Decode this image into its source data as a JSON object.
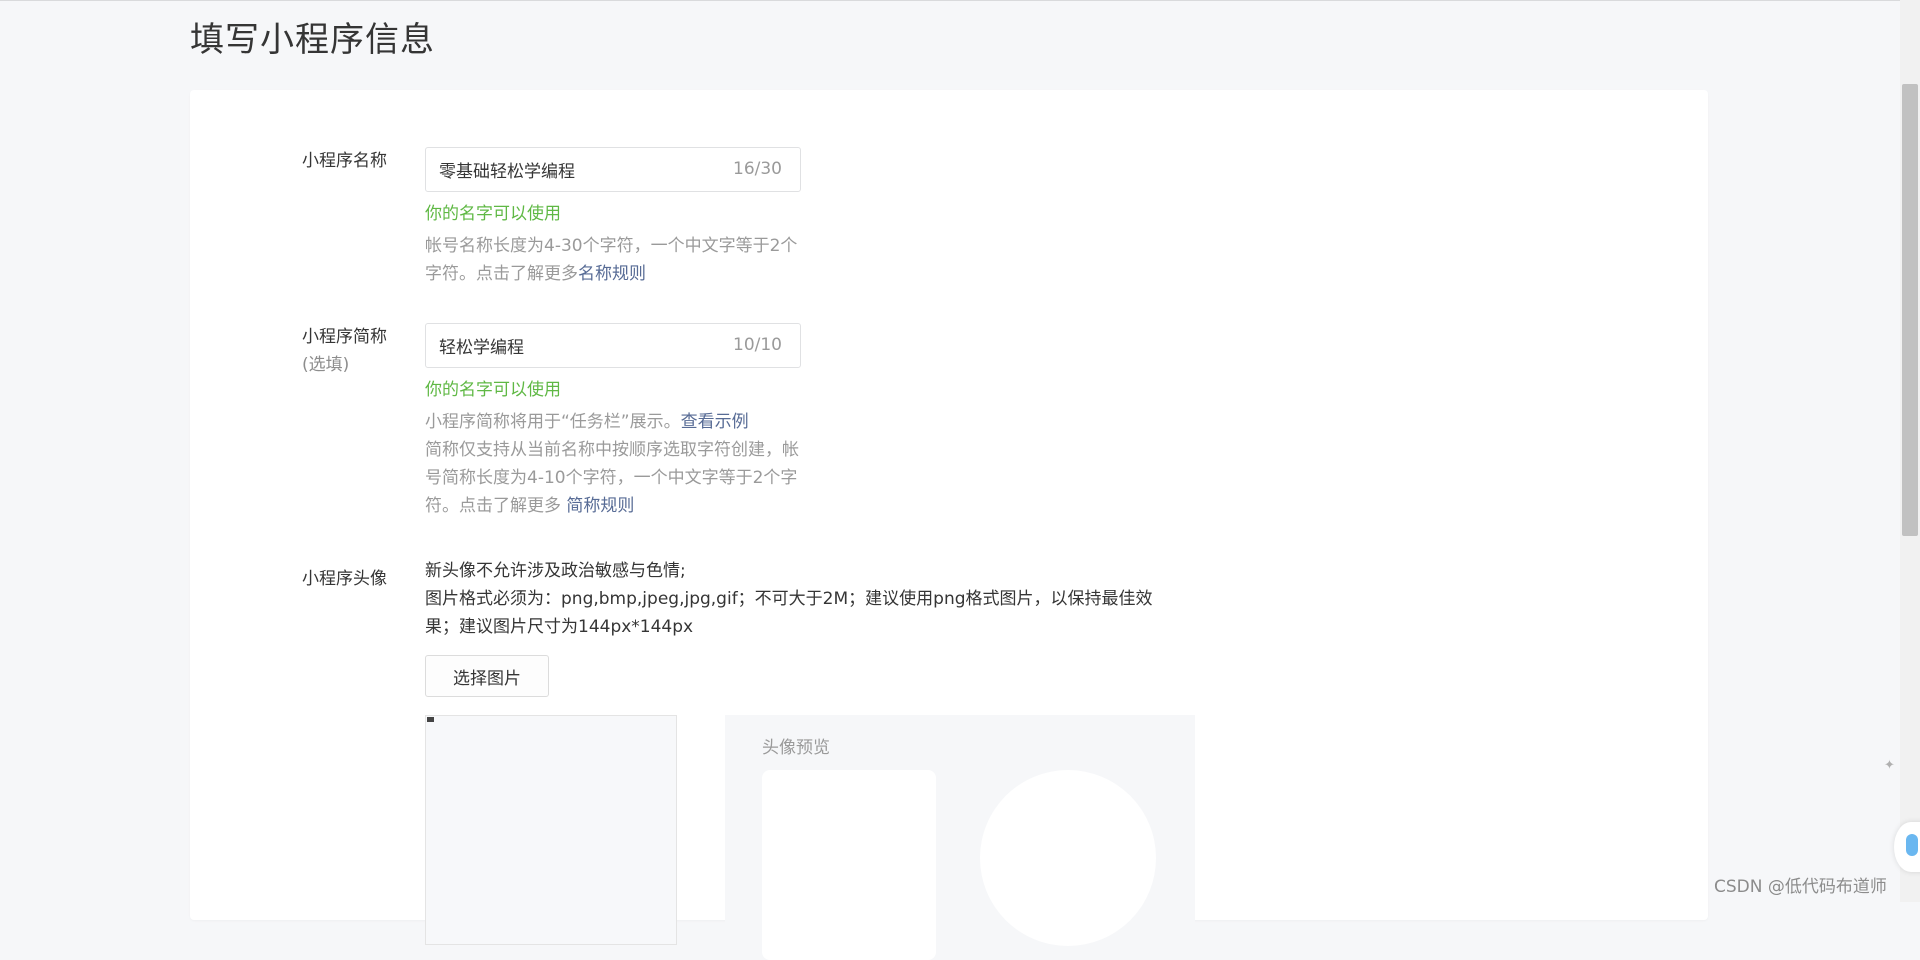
{
  "page": {
    "title": "填写小程序信息"
  },
  "name_field": {
    "label": "小程序名称",
    "value": "零基础轻松学编程",
    "counter": "16/30",
    "ok_tip": "你的名字可以使用",
    "help_text": "帐号名称长度为4-30个字符，一个中文字等于2个字符。点击了解更多",
    "help_link": "名称规则"
  },
  "short_name_field": {
    "label": "小程序简称",
    "optional": "(选填)",
    "value": "轻松学编程",
    "counter": "10/10",
    "ok_tip": "你的名字可以使用",
    "help_line1": "小程序简称将用于“任务栏”展示。",
    "help_link1": "查看示例",
    "help_line2": "简称仅支持从当前名称中按顺序选取字符创建，帐号简称长度为4-10个字符，一个中文字等于2个字符。点击了解更多 ",
    "help_link2": "简称规则"
  },
  "avatar_field": {
    "label": "小程序头像",
    "desc_line1": "新头像不允许涉及政治敏感与色情;",
    "desc_line2": "图片格式必须为：png,bmp,jpeg,jpg,gif；不可大于2M；建议使用png格式图片，以保持最佳效果；建议图片尺寸为144px*144px",
    "choose_button": "选择图片",
    "preview_title": "头像预览"
  },
  "watermark": "CSDN @低代码布道师"
}
